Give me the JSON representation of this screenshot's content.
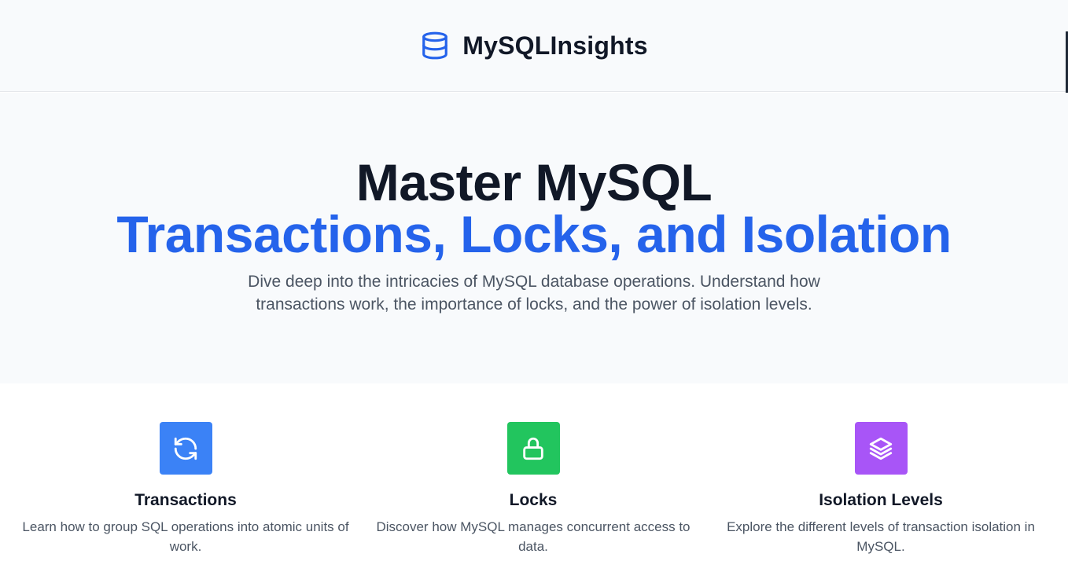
{
  "brand": {
    "name": "MySQLInsights",
    "icon": "database-icon",
    "icon_color": "#2563eb"
  },
  "hero": {
    "title_line1": "Master MySQL",
    "title_line2": "Transactions, Locks, and Isolation",
    "subtitle": "Dive deep into the intricacies of MySQL database operations. Understand how transactions work, the importance of locks, and the power of isolation levels.",
    "accent_color": "#2563eb"
  },
  "features": [
    {
      "title": "Transactions",
      "description": "Learn how to group SQL operations into atomic units of work.",
      "icon": "refresh-icon",
      "color": "#3b82f6"
    },
    {
      "title": "Locks",
      "description": "Discover how MySQL manages concurrent access to data.",
      "icon": "lock-icon",
      "color": "#22c55e"
    },
    {
      "title": "Isolation Levels",
      "description": "Explore the different levels of transaction isolation in MySQL.",
      "icon": "layers-icon",
      "color": "#a855f7"
    }
  ]
}
